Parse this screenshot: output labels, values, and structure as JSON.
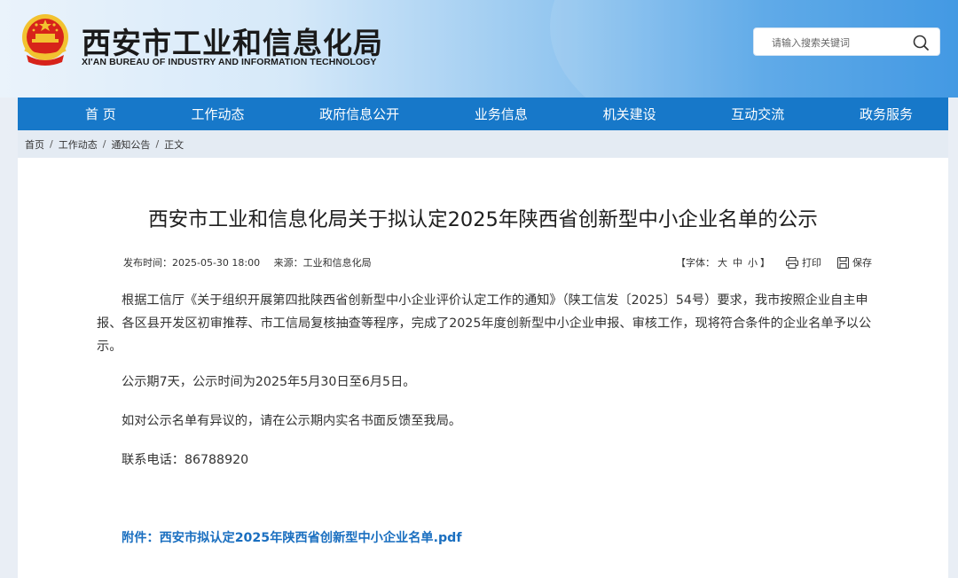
{
  "header": {
    "title": "西安市工业和信息化局",
    "subtitle": "XI'AN BUREAU OF INDUSTRY AND INFORMATION TECHNOLOGY",
    "search_placeholder": "请输入搜索关键词"
  },
  "nav": {
    "items": [
      "首  页",
      "工作动态",
      "政府信息公开",
      "业务信息",
      "机关建设",
      "互动交流",
      "政务服务"
    ]
  },
  "breadcrumb": {
    "items": [
      "首页",
      "工作动态",
      "通知公告",
      "正文"
    ],
    "separator": "/"
  },
  "article": {
    "title": "西安市工业和信息化局关于拟认定2025年陕西省创新型中小企业名单的公示",
    "publish_time": "发布时间：2025-05-30 18:00",
    "source": "来源：工业和信息化局",
    "font_label": "【字体：",
    "font_sizes": [
      "大",
      "中",
      "小"
    ],
    "font_close": "】",
    "print_label": "打印",
    "save_label": "保存",
    "paragraph1": "根据工信厅《关于组织开展第四批陕西省创新型中小企业评价认定工作的通知》（陕工信发〔2025〕54号）要求，我市按照企业自主申报、各区县开发区初审推荐、市工信局复核抽查等程序，完成了2025年度创新型中小企业申报、审核工作，现将符合条件的企业名单予以公示。",
    "paragraph2": "公示期7天，公示时间为2025年5月30日至6月5日。",
    "paragraph3": "如对公示名单有异议的，请在公示期内实名书面反馈至我局。",
    "paragraph4": "联系电话：86788920",
    "attachment": "附件：西安市拟认定2025年陕西省创新型中小企业名单.pdf"
  },
  "colors": {
    "nav_bg": "#1778c9",
    "link": "#1a6fc0",
    "emblem_red": "#d7231a",
    "emblem_gold": "#f2c230"
  },
  "icons": [
    "national-emblem-icon",
    "search-icon",
    "print-icon",
    "save-icon"
  ]
}
